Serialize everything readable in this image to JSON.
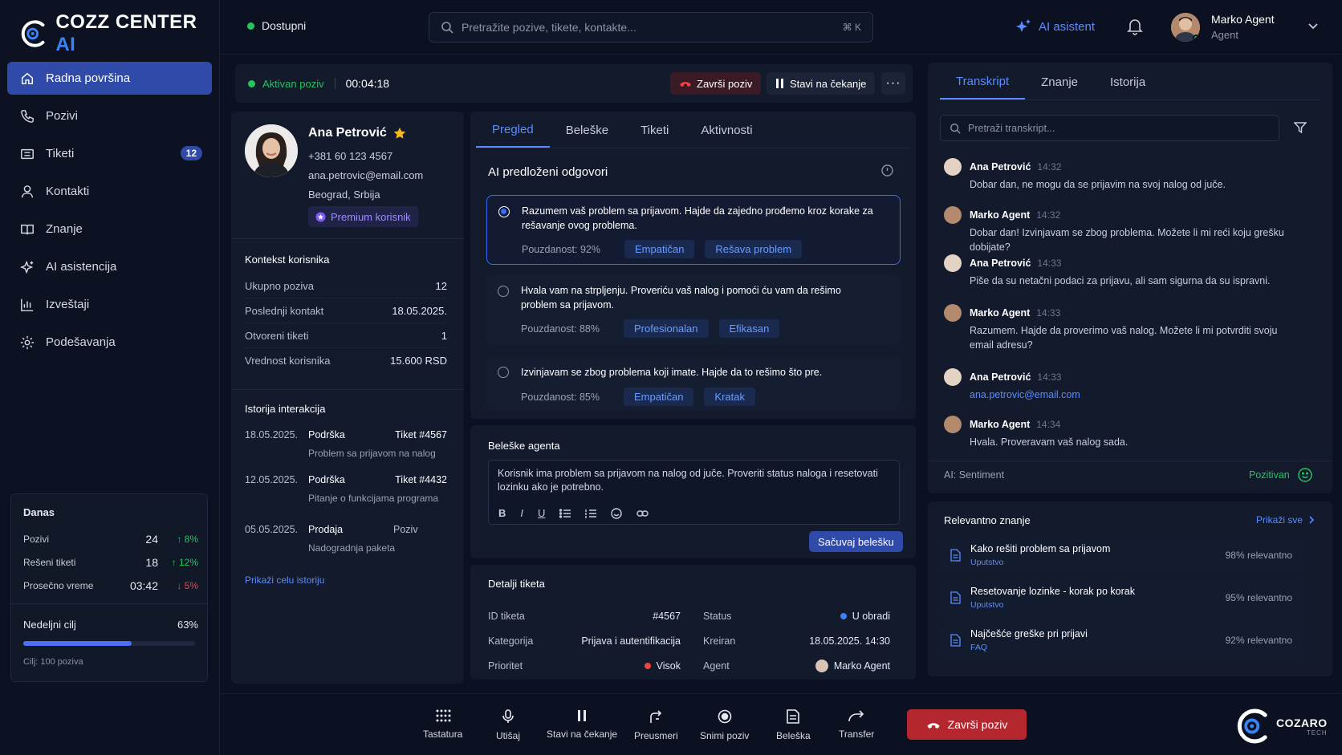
{
  "brand": {
    "name_main": "COZZ CENTER",
    "name_ai": "AI"
  },
  "sidebar": {
    "items": [
      {
        "label": "Radna površina",
        "icon": "home-icon"
      },
      {
        "label": "Pozivi",
        "icon": "phone-icon"
      },
      {
        "label": "Tiketi",
        "icon": "ticket-icon",
        "badge": "12"
      },
      {
        "label": "Kontakti",
        "icon": "user-icon"
      },
      {
        "label": "Znanje",
        "icon": "book-icon"
      },
      {
        "label": "AI asistencija",
        "icon": "sparkle-icon"
      },
      {
        "label": "Izveštaji",
        "icon": "chart-icon"
      },
      {
        "label": "Podešavanja",
        "icon": "gear-icon"
      }
    ],
    "today": {
      "title": "Danas",
      "stats": [
        {
          "label": "Pozivi",
          "value": "24",
          "delta": "8%",
          "trend": "up"
        },
        {
          "label": "Rešeni tiketi",
          "value": "18",
          "delta": "12%",
          "trend": "up"
        },
        {
          "label": "Prosečno vreme",
          "value": "03:42",
          "delta": "5%",
          "trend": "down"
        }
      ],
      "goal_label": "Nedeljni cilj",
      "goal_percent": "63%",
      "goal_fraction": 0.63,
      "goal_target": "Cilj: 100 poziva"
    }
  },
  "header": {
    "status": "Dostupni",
    "search_placeholder": "Pretražite pozive, tikete, kontakte...",
    "search_shortcut": "⌘ K",
    "ai_assistant": "AI asistent",
    "user_name": "Marko Agent",
    "user_role": "Agent"
  },
  "call": {
    "status": "Aktivan poziv",
    "timer": "00:04:18",
    "end_label": "Završi poziv",
    "hold_label": "Stavi na čekanje"
  },
  "customer": {
    "name": "Ana Petrović",
    "phone": "+381 60 123 4567",
    "email": "ana.petrovic@email.com",
    "location": "Beograd, Srbija",
    "badge": "Premium korisnik",
    "context_title": "Kontekst korisnika",
    "context": [
      {
        "label": "Ukupno poziva",
        "value": "12"
      },
      {
        "label": "Poslednji kontakt",
        "value": "18.05.2025."
      },
      {
        "label": "Otvoreni tiketi",
        "value": "1"
      },
      {
        "label": "Vrednost korisnika",
        "value": "15.600 RSD"
      }
    ],
    "history_title": "Istorija interakcija",
    "history": [
      {
        "date": "18.05.2025.",
        "type": "Podrška",
        "ref": "Tiket #4567",
        "desc": "Problem sa prijavom na nalog"
      },
      {
        "date": "12.05.2025.",
        "type": "Podrška",
        "ref": "Tiket #4432",
        "desc": "Pitanje o funkcijama programa"
      },
      {
        "date": "05.05.2025.",
        "type": "Prodaja",
        "ref": "Poziv",
        "desc": "Nadogradnja paketa"
      }
    ],
    "history_link": "Prikaži celu istoriju"
  },
  "center": {
    "tabs": [
      "Pregled",
      "Beleške",
      "Tiketi",
      "Aktivnosti"
    ],
    "suggestions_title": "AI predloženi odgovori",
    "suggestions": [
      {
        "text": "Razumem vaš problem sa prijavom. Hajde da zajedno prođemo kroz korake za rešavanje ovog problema.",
        "confidence": "Pouzdanost: 92%",
        "tags": [
          "Empatičan",
          "Rešava problem"
        ]
      },
      {
        "text": "Hvala vam na strpljenju. Proveriću vaš nalog i pomoći ću vam da rešimo problem sa prijavom.",
        "confidence": "Pouzdanost: 88%",
        "tags": [
          "Profesionalan",
          "Efikasan"
        ]
      },
      {
        "text": "Izvinjavam se zbog problema koji imate. Hajde da to rešimo što pre.",
        "confidence": "Pouzdanost: 85%",
        "tags": [
          "Empatičan",
          "Kratak"
        ]
      }
    ],
    "notes_title": "Beleške agenta",
    "notes_text": "Korisnik ima problem sa prijavom na nalog od juče. Proveriti status naloga i resetovati lozinku ako je potrebno.",
    "save_note": "Sačuvaj belešku",
    "ticket_title": "Detalji tiketa",
    "ticket": {
      "id_label": "ID tiketa",
      "id": "#4567",
      "status_label": "Status",
      "status": "U obradi",
      "category_label": "Kategorija",
      "category": "Prijava i autentifikacija",
      "created_label": "Kreiran",
      "created": "18.05.2025. 14:30",
      "priority_label": "Prioritet",
      "priority": "Visok",
      "agent_label": "Agent",
      "agent": "Marko Agent"
    }
  },
  "right": {
    "tabs": [
      "Transkript",
      "Znanje",
      "Istorija"
    ],
    "search_placeholder": "Pretraži transkript...",
    "transcript": [
      {
        "name": "Ana Petrović",
        "time": "14:32",
        "text": "Dobar dan, ne mogu da se prijavim na svoj nalog od juče."
      },
      {
        "name": "Marko Agent",
        "time": "14:32",
        "text": "Dobar dan! Izvinjavam se zbog problema. Možete li mi reći koju grešku dobijate?"
      },
      {
        "name": "Ana Petrović",
        "time": "14:33",
        "text": "Piše da su netačni podaci za prijavu, ali sam sigurna da su ispravni."
      },
      {
        "name": "Marko Agent",
        "time": "14:33",
        "text": "Razumem. Hajde da proverimo vaš nalog. Možete li mi potvrditi svoju email adresu?"
      },
      {
        "name": "Ana Petrović",
        "time": "14:33",
        "text": "ana.petrovic@email.com"
      },
      {
        "name": "Marko Agent",
        "time": "14:34",
        "text": "Hvala. Proveravam vaš nalog sada."
      }
    ],
    "sentiment_label": "AI: Sentiment",
    "sentiment_value": "Pozitivan",
    "knowledge_title": "Relevantno znanje",
    "knowledge_link": "Prikaži sve",
    "knowledge": [
      {
        "title": "Kako rešiti problem sa prijavom",
        "type": "Uputstvo",
        "score": "98% relevantno"
      },
      {
        "title": "Resetovanje lozinke - korak po korak",
        "type": "Uputstvo",
        "score": "95% relevantno"
      },
      {
        "title": "Najčešće greške pri prijavi",
        "type": "FAQ",
        "score": "92% relevantno"
      }
    ]
  },
  "footer": {
    "actions": [
      "Tastatura",
      "Utišaj",
      "Stavi na čekanje",
      "Preusmeri",
      "Snimi poziv",
      "Beleška",
      "Transfer"
    ],
    "end_call": "Završi poziv",
    "brand": "COZARO",
    "brand_sub": "TECH"
  },
  "colors": {
    "accent": "#3b6cf2",
    "green": "#22c55e",
    "red": "#ef4444",
    "bg": "#0b1120"
  }
}
